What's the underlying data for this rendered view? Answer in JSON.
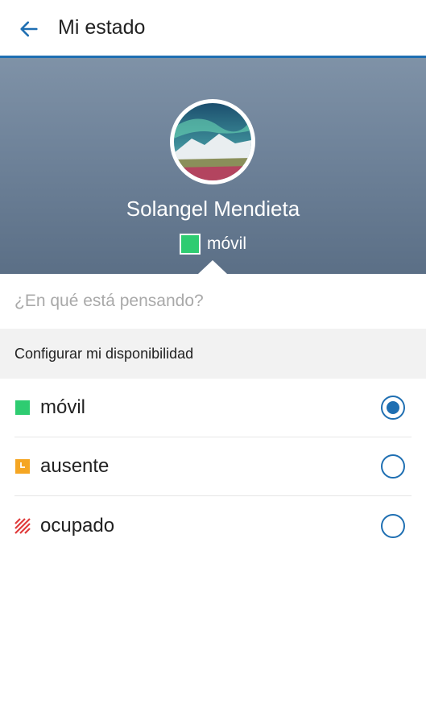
{
  "appbar": {
    "title": "Mi estado"
  },
  "profile": {
    "name": "Solangel Mendieta",
    "status_label": "móvil",
    "status_color": "#2ecc71"
  },
  "thought": {
    "placeholder": "¿En qué está pensando?",
    "value": ""
  },
  "availability": {
    "header": "Configurar mi disponibilidad",
    "options": [
      {
        "label": "móvil",
        "icon": "green-square-icon",
        "color": "#2ecc71",
        "selected": true
      },
      {
        "label": "ausente",
        "icon": "clock-icon",
        "color": "#f5a623",
        "selected": false
      },
      {
        "label": "ocupado",
        "icon": "striped-icon",
        "color": "#e03b3b",
        "selected": false
      }
    ]
  },
  "colors": {
    "accent": "#1f6fb2",
    "hero_bg": "#6e8299"
  }
}
